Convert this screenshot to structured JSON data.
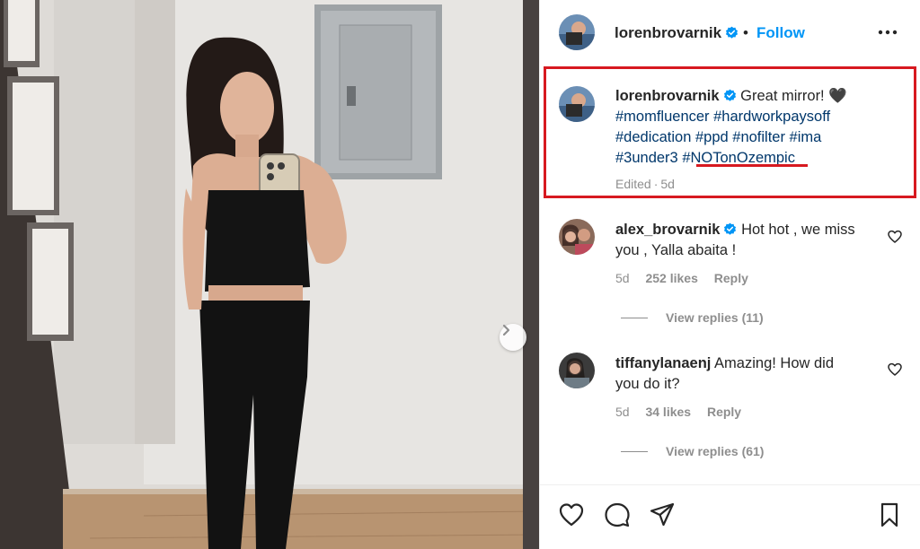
{
  "post": {
    "username": "lorenbrovarnik",
    "separator": "•",
    "follow_label": "Follow",
    "more_icon": "more-options-icon"
  },
  "caption": {
    "username": "lorenbrovarnik",
    "text": "Great mirror!",
    "emoji": "🖤",
    "hashtags_line1": "#momfluencer #hardworkpaysoff",
    "hashtags_line2": "#dedication #ppd #nofilter #ima",
    "hashtags_line3a": "#3under3",
    "hashtags_line3b": "#NOTonOzempic",
    "edited": "Edited",
    "dot": "·",
    "age": "5d"
  },
  "comments": [
    {
      "username": "alex_brovarnik",
      "verified": true,
      "line1": "Hot hot , we miss",
      "line2": "you , Yalla abaita !",
      "age": "5d",
      "likes": "252 likes",
      "reply": "Reply",
      "view_replies": "View replies (11)"
    },
    {
      "username": "tiffanylanaenj",
      "verified": false,
      "line1": "Amazing! How did",
      "line2": "you do it?",
      "age": "5d",
      "likes": "34 likes",
      "reply": "Reply",
      "view_replies": "View replies (61)"
    }
  ],
  "colors": {
    "verified_blue": "#0095f6",
    "hashtag": "#00376b",
    "highlight_red": "#d71920",
    "muted": "#8e8e8e"
  }
}
